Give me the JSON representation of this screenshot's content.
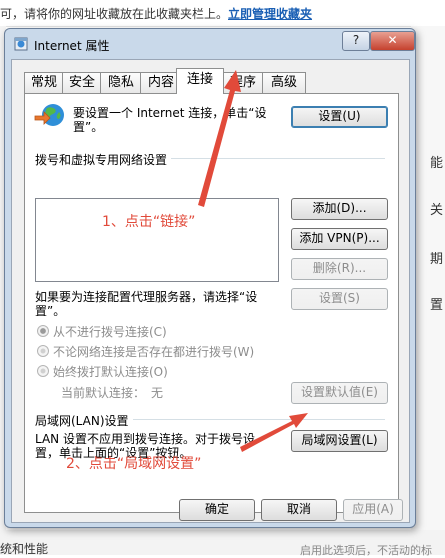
{
  "background": {
    "notice": "可，请将你的网址收藏放在此收藏夹栏上。",
    "manage_link": "立即管理收藏夹",
    "right_fragments": [
      "能",
      "关",
      "期",
      "置"
    ],
    "bottom_left": "统和性能",
    "bottom_right": "启用此选项后，不活动的标"
  },
  "dialog": {
    "title": "Internet 属性",
    "help_label": "?",
    "close_label": "✕",
    "tabs": [
      "常规",
      "安全",
      "隐私",
      "内容",
      "连接",
      "程序",
      "高级"
    ],
    "active_tab": "连接",
    "setup": {
      "text": "要设置一个 Internet 连接，单击“设置”。",
      "button": "设置(U)"
    },
    "dialup": {
      "group_title": "拨号和虚拟专用网络设置",
      "add_button": "添加(D)...",
      "add_vpn_button": "添加 VPN(P)...",
      "delete_button": "删除(R)...",
      "proxy_text": "如果要为连接配置代理服务器，请选择“设置”。",
      "settings_button": "设置(S)",
      "options": [
        {
          "label": "从不进行拨号连接(C)",
          "checked": true
        },
        {
          "label": "不论网络连接是否存在都进行拨号(W)",
          "checked": false
        },
        {
          "label": "始终拨打默认连接(O)",
          "checked": false
        }
      ],
      "default_label": "当前默认连接：",
      "default_value": "无",
      "set_default_button": "设置默认值(E)"
    },
    "lan": {
      "group_title": "局域网(LAN)设置",
      "text": "LAN 设置不应用到拨号连接。对于拨号设置，单击上面的“设置”按钮。",
      "button": "局域网设置(L)"
    },
    "footer": {
      "ok": "确定",
      "cancel": "取消",
      "apply": "应用(A)"
    }
  },
  "annotations": {
    "step1": "1、点击“链接”",
    "step2": "2、点击“局域网设置”",
    "color": "#e14a3a"
  }
}
